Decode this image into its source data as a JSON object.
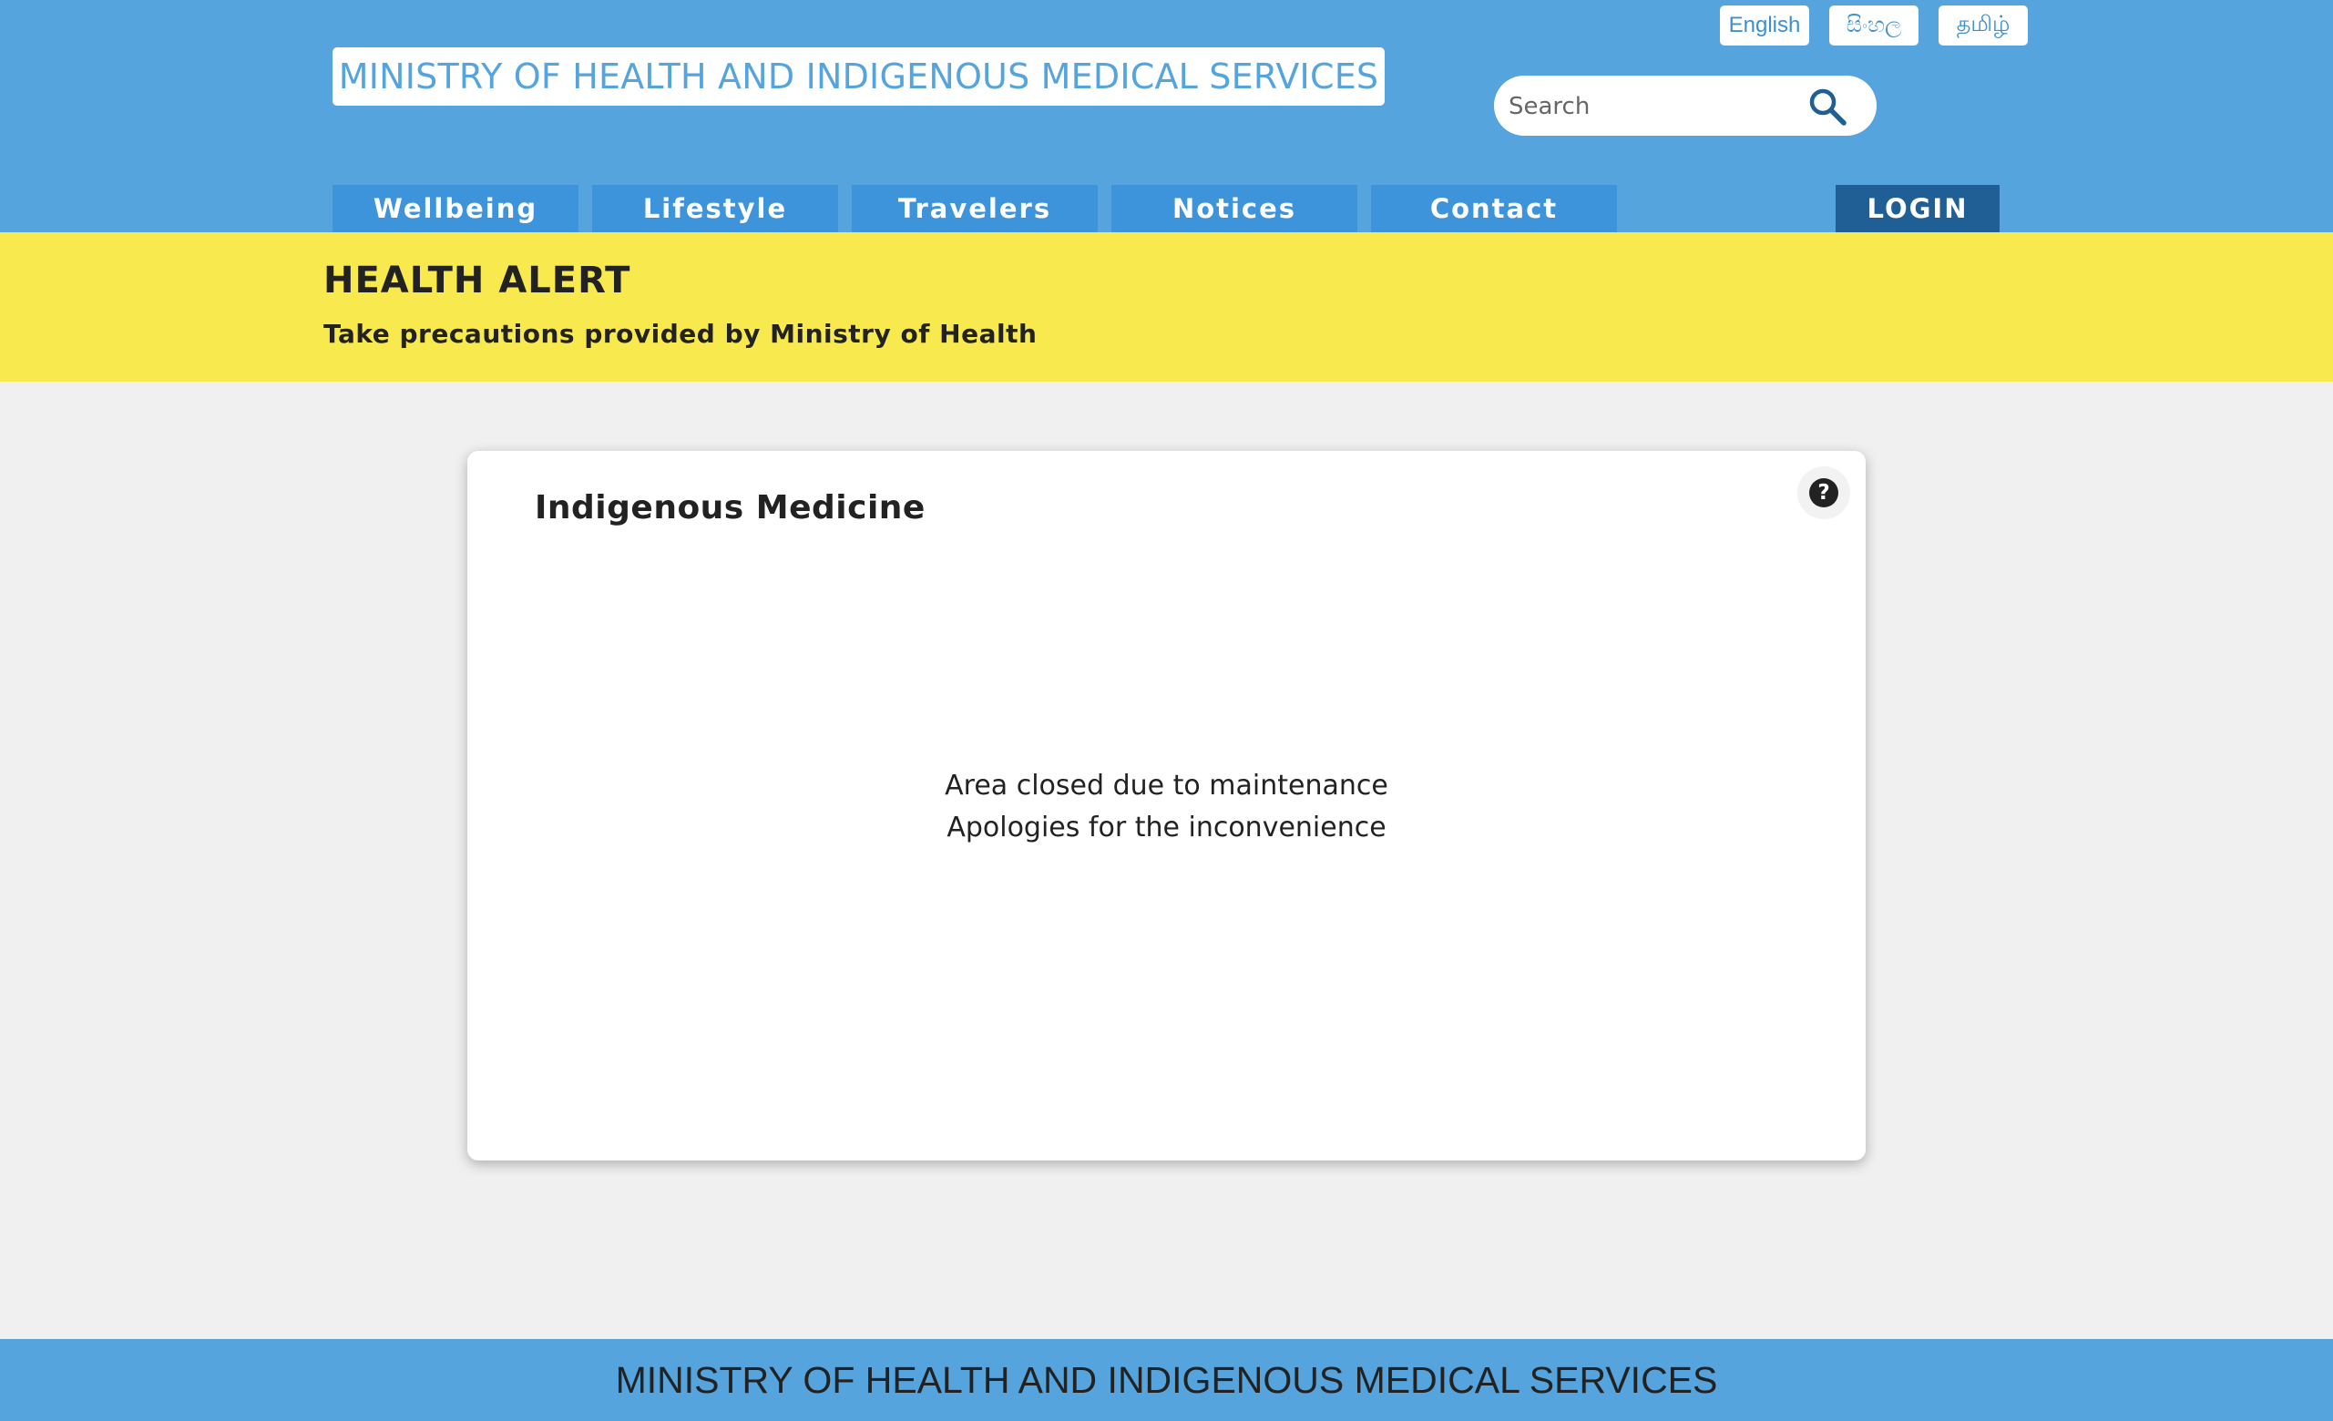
{
  "header": {
    "title": "MINISTRY OF HEALTH AND INDIGENOUS MEDICAL SERVICES",
    "languages": [
      "English",
      "සිංහල",
      "தமிழ்"
    ],
    "search": {
      "placeholder": "Search",
      "value": ""
    },
    "nav": [
      "Wellbeing",
      "Lifestyle",
      "Travelers",
      "Notices",
      "Contact"
    ],
    "login_label": "LOGIN"
  },
  "alert": {
    "title": "HEALTH ALERT",
    "subtitle": "Take precautions provided by Ministry of Health"
  },
  "card": {
    "title": "Indigenous Medicine",
    "help_icon": "?",
    "message_line1": "Area closed due to maintenance",
    "message_line2": "Apologies for the inconvenience"
  },
  "footer": {
    "text": "MINISTRY OF HEALTH AND INDIGENOUS MEDICAL SERVICES"
  },
  "colors": {
    "header_bg": "#55a4dd",
    "nav_bg": "#3e94db",
    "login_bg": "#1f5f96",
    "alert_bg": "#f8ea4e",
    "page_bg": "#f0f0f0"
  }
}
